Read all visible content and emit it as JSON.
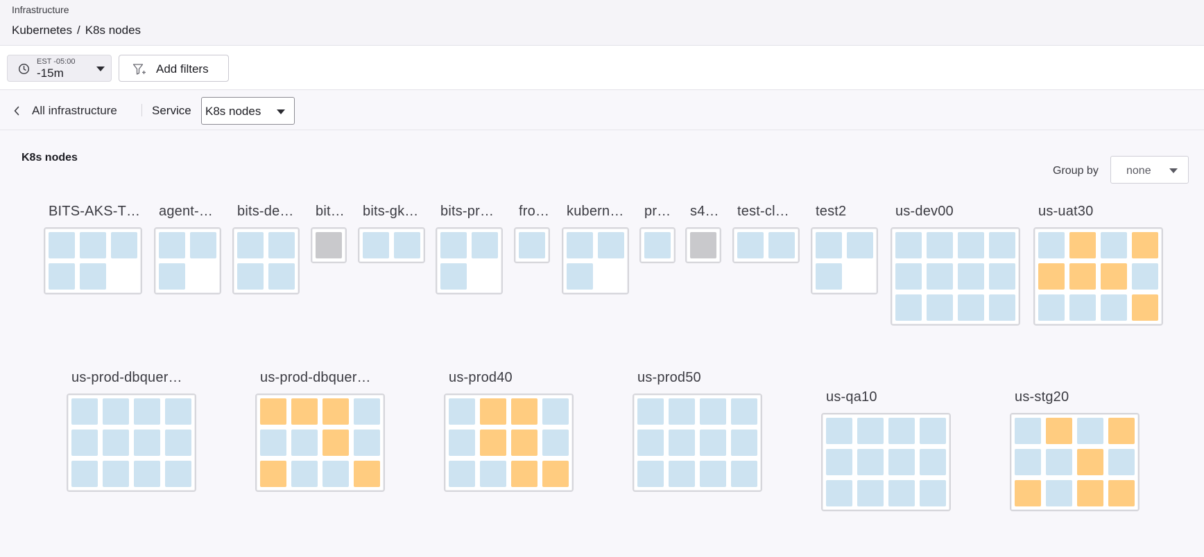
{
  "header": {
    "section": "Infrastructure",
    "breadcrumb": [
      "Kubernetes",
      "K8s nodes"
    ],
    "separator": "/"
  },
  "filters": {
    "timezone": "EST -05:00",
    "time_range": "-15m",
    "add_filters_label": "Add filters"
  },
  "service_bar": {
    "back_label": "All infrastructure",
    "service_label": "Service",
    "service_value": "K8s nodes"
  },
  "content": {
    "title": "K8s nodes",
    "group_by_label": "Group by",
    "group_by_value": "none"
  },
  "colors": {
    "healthy": "#cde3f1",
    "warning": "#ffcc80",
    "inactive": "#c9c9cc"
  },
  "clusters": [
    {
      "name": "BITS-AKS-T…",
      "cols": 3,
      "nodes": [
        "h",
        "h",
        "h",
        "h",
        "h"
      ]
    },
    {
      "name": "agent-…",
      "cols": 2,
      "nodes": [
        "h",
        "h",
        "h"
      ]
    },
    {
      "name": "bits-de…",
      "cols": 2,
      "nodes": [
        "h",
        "h",
        "h",
        "h"
      ]
    },
    {
      "name": "bit…",
      "cols": 1,
      "nodes": [
        "g"
      ]
    },
    {
      "name": "bits-gk…",
      "cols": 2,
      "nodes": [
        "h",
        "h"
      ]
    },
    {
      "name": "bits-pr…",
      "cols": 2,
      "nodes": [
        "h",
        "h",
        "h"
      ]
    },
    {
      "name": "fro…",
      "cols": 1,
      "nodes": [
        "h"
      ]
    },
    {
      "name": "kubern…",
      "cols": 2,
      "nodes": [
        "h",
        "h",
        "h"
      ]
    },
    {
      "name": "pr…",
      "cols": 1,
      "nodes": [
        "h"
      ]
    },
    {
      "name": "s4…",
      "cols": 1,
      "nodes": [
        "g"
      ]
    },
    {
      "name": "test-cl…",
      "cols": 2,
      "nodes": [
        "h",
        "h"
      ]
    },
    {
      "name": "test2",
      "cols": 2,
      "nodes": [
        "h",
        "h",
        "h"
      ]
    },
    {
      "name": "us-dev00",
      "cols": 4,
      "nodes": [
        "h",
        "h",
        "h",
        "h",
        "h",
        "h",
        "h",
        "h",
        "h",
        "h",
        "h",
        "h"
      ]
    },
    {
      "name": "us-uat30",
      "cols": 4,
      "nodes": [
        "h",
        "w",
        "h",
        "w",
        "w",
        "w",
        "w",
        "h",
        "h",
        "h",
        "h",
        "w"
      ]
    },
    {
      "name": "us-prod-dbquer…",
      "cols": 4,
      "nodes": [
        "h",
        "h",
        "h",
        "h",
        "h",
        "h",
        "h",
        "h",
        "h",
        "h",
        "h",
        "h"
      ]
    },
    {
      "name": "us-prod-dbquer…",
      "cols": 4,
      "nodes": [
        "w",
        "w",
        "w",
        "h",
        "h",
        "h",
        "w",
        "h",
        "w",
        "h",
        "h",
        "w"
      ]
    },
    {
      "name": "us-prod40",
      "cols": 4,
      "nodes": [
        "h",
        "w",
        "w",
        "h",
        "h",
        "w",
        "w",
        "h",
        "h",
        "h",
        "w",
        "w"
      ]
    },
    {
      "name": "us-prod50",
      "cols": 4,
      "nodes": [
        "h",
        "h",
        "h",
        "h",
        "h",
        "h",
        "h",
        "h",
        "h",
        "h",
        "h",
        "h"
      ]
    },
    {
      "name": "us-qa10",
      "cols": 4,
      "nodes": [
        "h",
        "h",
        "h",
        "h",
        "h",
        "h",
        "h",
        "h",
        "h",
        "h",
        "h",
        "h"
      ]
    },
    {
      "name": "us-stg20",
      "cols": 4,
      "nodes": [
        "h",
        "w",
        "h",
        "w",
        "h",
        "h",
        "w",
        "h",
        "w",
        "h",
        "w",
        "w"
      ]
    }
  ]
}
